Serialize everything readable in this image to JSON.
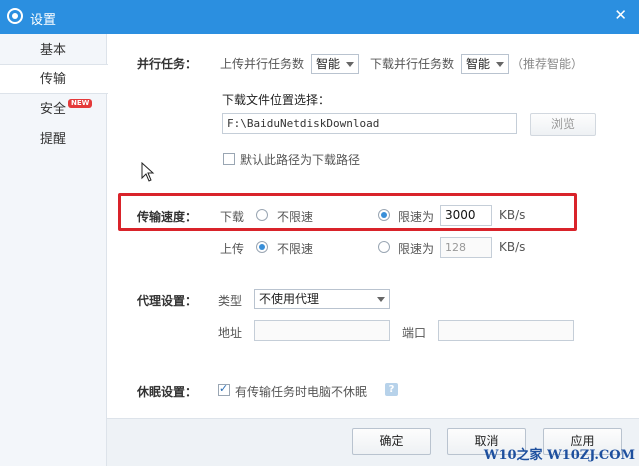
{
  "window": {
    "title": "设置",
    "close_glyph": "✕"
  },
  "sidebar": {
    "items": [
      {
        "label": "基本"
      },
      {
        "label": "传输"
      },
      {
        "label": "安全",
        "badge": "NEW"
      },
      {
        "label": "提醒"
      }
    ]
  },
  "parallel": {
    "label": "并行任务：",
    "upload_label": "上传并行任务数",
    "upload_value": "智能",
    "download_label": "下载并行任务数",
    "download_value": "智能",
    "hint": "（推荐智能）"
  },
  "location": {
    "label": "下载文件位置选择：",
    "path": "F:\\BaiduNetdiskDownload",
    "browse_label": "浏览",
    "default_checkbox_label": "默认此路径为下载路径"
  },
  "speed": {
    "label": "传输速度：",
    "download": {
      "label": "下载",
      "unlimited_label": "不限速",
      "limit_label": "限速为",
      "limit_value": "3000",
      "unit": "KB/s",
      "selected": "limit"
    },
    "upload": {
      "label": "上传",
      "unlimited_label": "不限速",
      "limit_label": "限速为",
      "limit_value": "128",
      "unit": "KB/s",
      "selected": "unlimited"
    }
  },
  "proxy": {
    "label": "代理设置：",
    "type_label": "类型",
    "type_value": "不使用代理",
    "address_label": "地址",
    "port_label": "端口"
  },
  "sleep": {
    "label": "休眠设置：",
    "checkbox_label": "有传输任务时电脑不休眠",
    "help_glyph": "?"
  },
  "buttons": {
    "ok": "确定",
    "cancel": "取消",
    "apply": "应用"
  },
  "watermark": "W10之家 W10ZJ.COM",
  "colors": {
    "titlebar": "#2b8fe0",
    "highlight": "#d9232a",
    "accent": "#3a8fd8"
  }
}
